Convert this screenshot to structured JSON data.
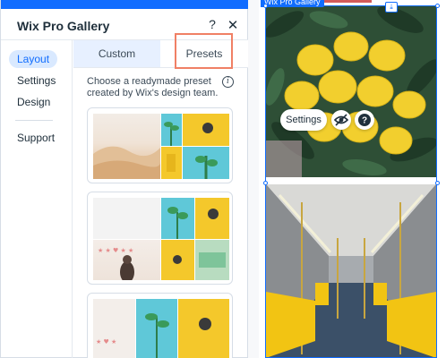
{
  "panel": {
    "title": "Wix Pro Gallery",
    "help_glyph": "?",
    "close_glyph": "✕",
    "sidebar": [
      "Layout",
      "Settings",
      "Design",
      "Support"
    ],
    "tabs": [
      "Custom",
      "Presets"
    ],
    "description": "Choose a readymade preset created by Wix's design team.",
    "info_glyph": "i"
  },
  "canvas": {
    "gallery_label": "Wix Pro Gallery",
    "hover_toolbar": {
      "settings_label": "Settings"
    }
  },
  "icons": {
    "help": "help-icon",
    "close": "close-icon",
    "info": "info-icon",
    "hide": "eye-off-icon",
    "question": "question-icon",
    "download": "download-icon"
  },
  "colors": {
    "accent": "#116dff",
    "active_tab_bg": "#e7f0ff",
    "sidebar_active_bg": "#d9e9ff",
    "highlight": "#f08065",
    "text": "#20303c"
  }
}
